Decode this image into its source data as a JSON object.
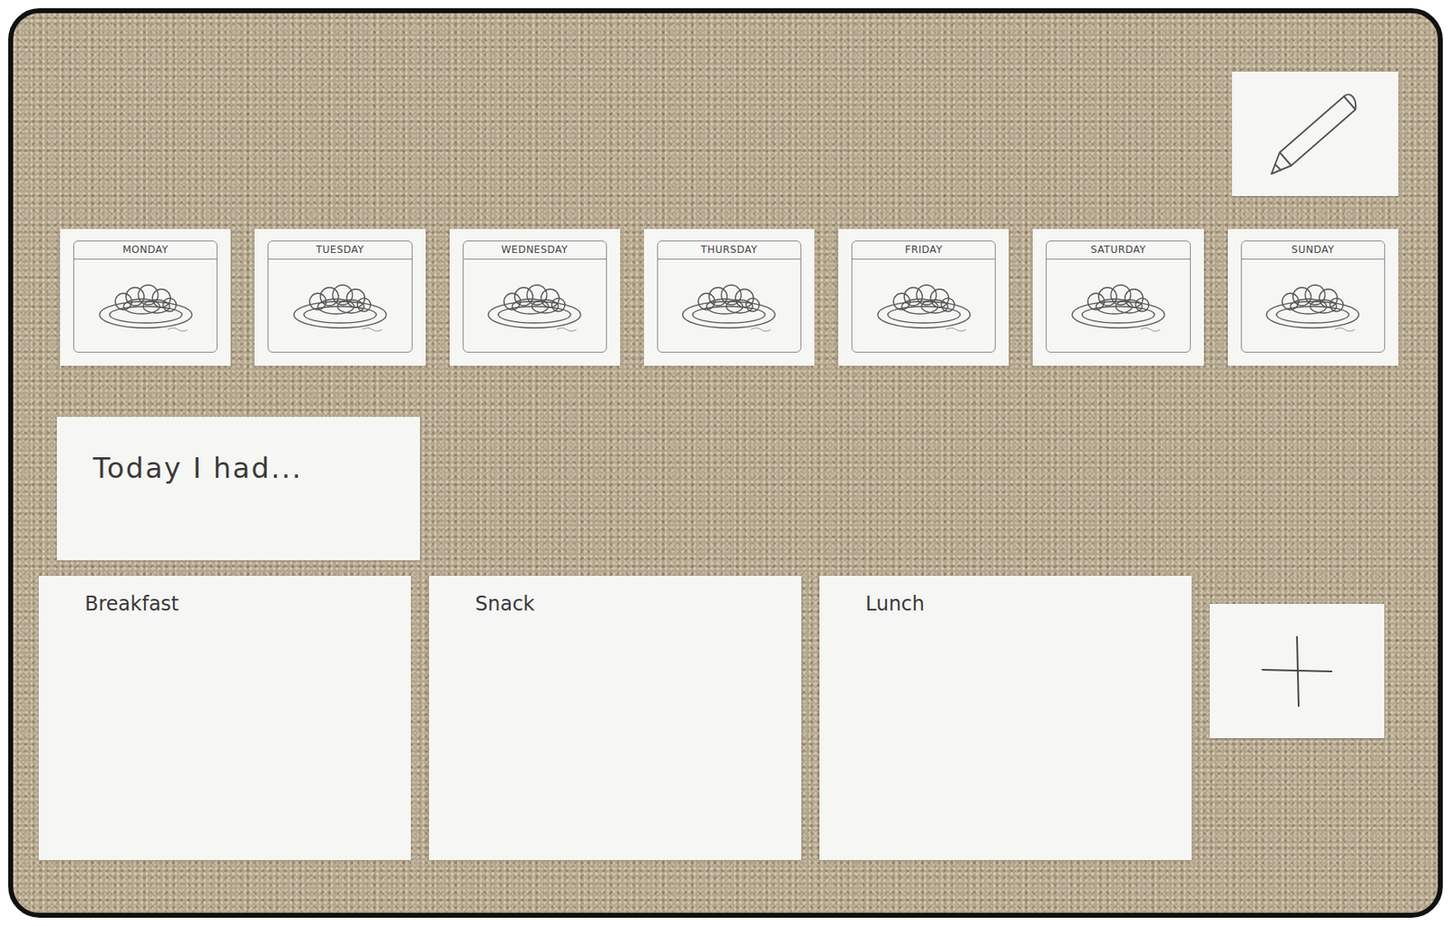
{
  "days": [
    {
      "label": "MONDAY"
    },
    {
      "label": "TUESDAY"
    },
    {
      "label": "WEDNESDAY"
    },
    {
      "label": "THURSDAY"
    },
    {
      "label": "FRIDAY"
    },
    {
      "label": "SATURDAY"
    },
    {
      "label": "SUNDAY"
    }
  ],
  "summary": {
    "title": "Today I had..."
  },
  "meals": [
    {
      "label": "Breakfast"
    },
    {
      "label": "Snack"
    },
    {
      "label": "Lunch"
    }
  ]
}
